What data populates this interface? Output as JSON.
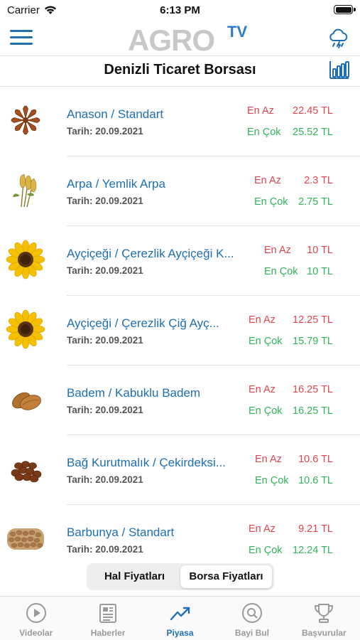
{
  "status_bar": {
    "carrier": "Carrier",
    "time": "6:13 PM"
  },
  "header": {
    "logo_main": "AGRO",
    "logo_tv": "TV",
    "title": "Denizli Ticaret Borsası",
    "menu_icon": "hamburger-menu-icon",
    "weather_icon": "cloud-rain-icon",
    "chart_icon": "bar-chart-icon"
  },
  "price_labels": {
    "min": "En Az",
    "max": "En Çok"
  },
  "colors": {
    "accent": "#1e6fb4",
    "min_price": "#e0444e",
    "max_price": "#2fb45a"
  },
  "items": [
    {
      "name": "Anason / Standart",
      "date": "Tarih: 20.09.2021",
      "min": "22.45 TL",
      "max": "25.52 TL",
      "icon": "star-anise-icon"
    },
    {
      "name": "Arpa / Yemlik Arpa",
      "date": "Tarih: 20.09.2021",
      "min": "2.3 TL",
      "max": "2.75 TL",
      "icon": "barley-icon"
    },
    {
      "name": "Ayçiçeği / Çerezlik Ayçiçeği K...",
      "date": "Tarih: 20.09.2021",
      "min": "10 TL",
      "max": "10 TL",
      "icon": "sunflower-icon"
    },
    {
      "name": "Ayçiçeği / Çerezlik Çiğ Ayç...",
      "date": "Tarih: 20.09.2021",
      "min": "12.25 TL",
      "max": "15.79 TL",
      "icon": "sunflower-icon"
    },
    {
      "name": "Badem / Kabuklu Badem",
      "date": "Tarih: 20.09.2021",
      "min": "16.25 TL",
      "max": "16.25 TL",
      "icon": "almond-icon"
    },
    {
      "name": "Bağ Kurutmalık / Çekirdeksi...",
      "date": "Tarih: 20.09.2021",
      "min": "10.6 TL",
      "max": "10.6 TL",
      "icon": "raisin-icon"
    },
    {
      "name": "Barbunya / Standart",
      "date": "Tarih: 20.09.2021",
      "min": "9.21 TL",
      "max": "12.24 TL",
      "icon": "beans-icon"
    }
  ],
  "segment": {
    "options": [
      "Hal Fiyatları",
      "Borsa Fiyatları"
    ],
    "selected": "Borsa Fiyatları"
  },
  "tabs": [
    {
      "label": "Videolar",
      "icon": "play-circle-icon"
    },
    {
      "label": "Haberler",
      "icon": "newspaper-icon"
    },
    {
      "label": "Piyasa",
      "icon": "trend-up-icon",
      "active": true
    },
    {
      "label": "Bayi Bul",
      "icon": "search-circle-icon"
    },
    {
      "label": "Başvurular",
      "icon": "trophy-icon"
    }
  ]
}
